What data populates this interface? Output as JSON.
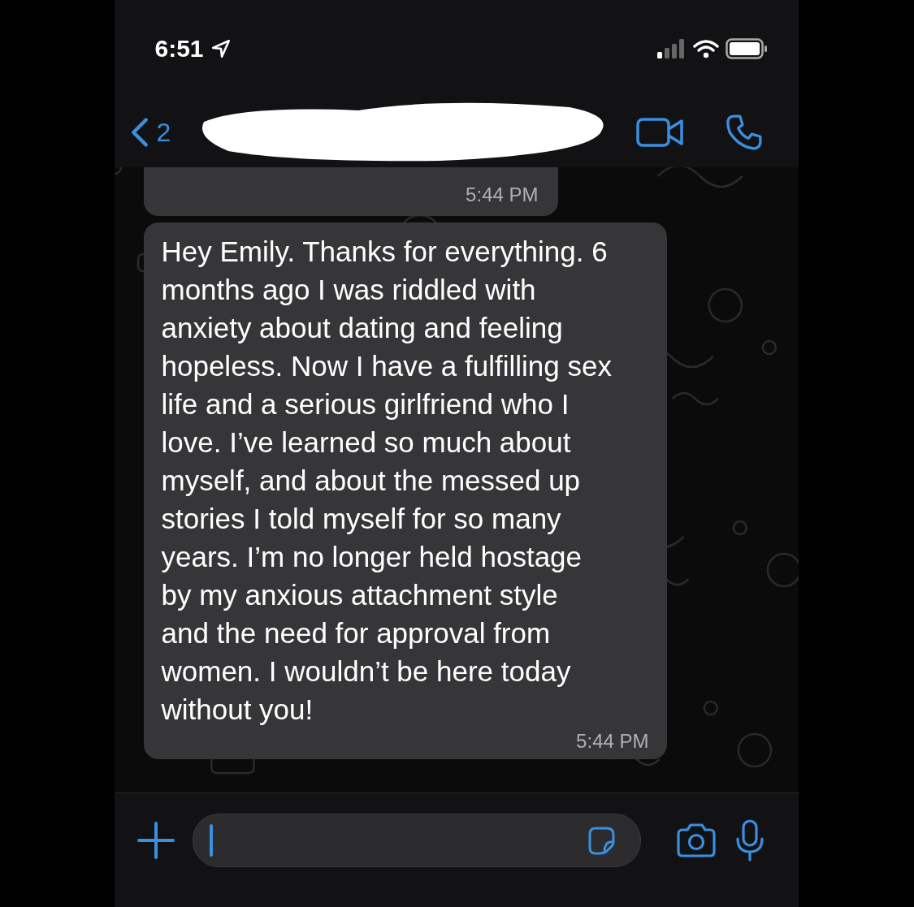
{
  "status_bar": {
    "time": "6:51"
  },
  "header": {
    "back_label": "2"
  },
  "messages": [
    {
      "kind": "cut",
      "time": "5:44 PM"
    },
    {
      "kind": "full",
      "text": "Hey Emily. Thanks for everything. 6\nmonths ago I was riddled with\nanxiety about dating and feeling\nhopeless. Now I have a fulfilling sex\nlife and a serious girlfriend who I\nlove. I’ve learned so much about\nmyself, and about the messed up\nstories I told myself for so many\nyears. I’m no longer held hostage\nby my anxious attachment style\nand the need for approval from\nwomen. I wouldn’t be here today\nwithout you!",
      "time": "5:44 PM"
    }
  ]
}
